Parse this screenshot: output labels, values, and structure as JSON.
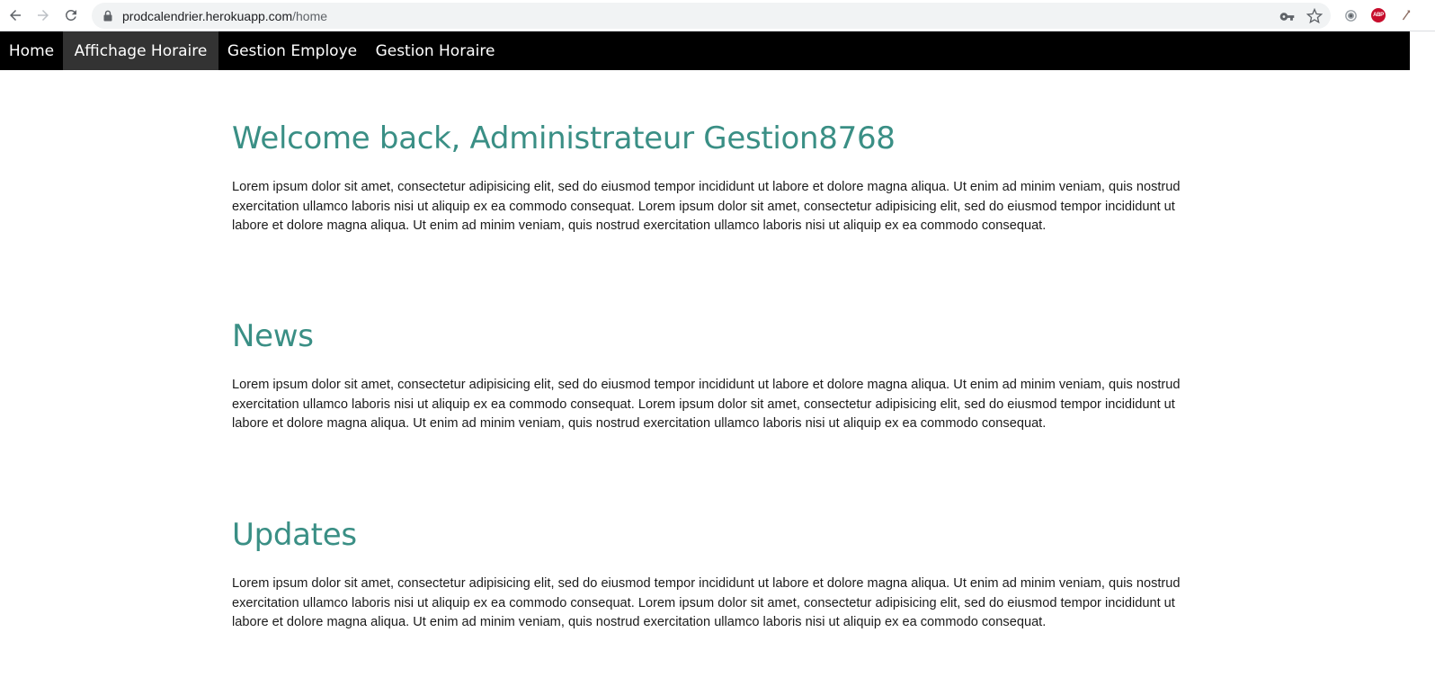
{
  "browser": {
    "url_host": "prodcalendrier.herokuapp.com",
    "url_path": "/home",
    "extension_abp_label": "ABP"
  },
  "navbar": {
    "items": [
      {
        "label": "Home",
        "active": false
      },
      {
        "label": "Affichage Horaire",
        "active": true
      },
      {
        "label": "Gestion Employe",
        "active": false
      },
      {
        "label": "Gestion Horaire",
        "active": false
      }
    ]
  },
  "sections": [
    {
      "title": "Welcome back, Administrateur Gestion8768",
      "text": "Lorem ipsum dolor sit amet, consectetur adipisicing elit, sed do eiusmod tempor incididunt ut labore et dolore magna aliqua. Ut enim ad minim veniam, quis nostrud exercitation ullamco laboris nisi ut aliquip ex ea commodo consequat. Lorem ipsum dolor sit amet, consectetur adipisicing elit, sed do eiusmod tempor incididunt ut labore et dolore magna aliqua. Ut enim ad minim veniam, quis nostrud exercitation ullamco laboris nisi ut aliquip ex ea commodo consequat."
    },
    {
      "title": "News",
      "text": "Lorem ipsum dolor sit amet, consectetur adipisicing elit, sed do eiusmod tempor incididunt ut labore et dolore magna aliqua. Ut enim ad minim veniam, quis nostrud exercitation ullamco laboris nisi ut aliquip ex ea commodo consequat. Lorem ipsum dolor sit amet, consectetur adipisicing elit, sed do eiusmod tempor incididunt ut labore et dolore magna aliqua. Ut enim ad minim veniam, quis nostrud exercitation ullamco laboris nisi ut aliquip ex ea commodo consequat."
    },
    {
      "title": "Updates",
      "text": "Lorem ipsum dolor sit amet, consectetur adipisicing elit, sed do eiusmod tempor incididunt ut labore et dolore magna aliqua. Ut enim ad minim veniam, quis nostrud exercitation ullamco laboris nisi ut aliquip ex ea commodo consequat. Lorem ipsum dolor sit amet, consectetur adipisicing elit, sed do eiusmod tempor incididunt ut labore et dolore magna aliqua. Ut enim ad minim veniam, quis nostrud exercitation ullamco laboris nisi ut aliquip ex ea commodo consequat."
    }
  ],
  "colors": {
    "heading": "#3a8f85",
    "navbar_bg": "#000000",
    "navbar_active_bg": "#333333"
  }
}
